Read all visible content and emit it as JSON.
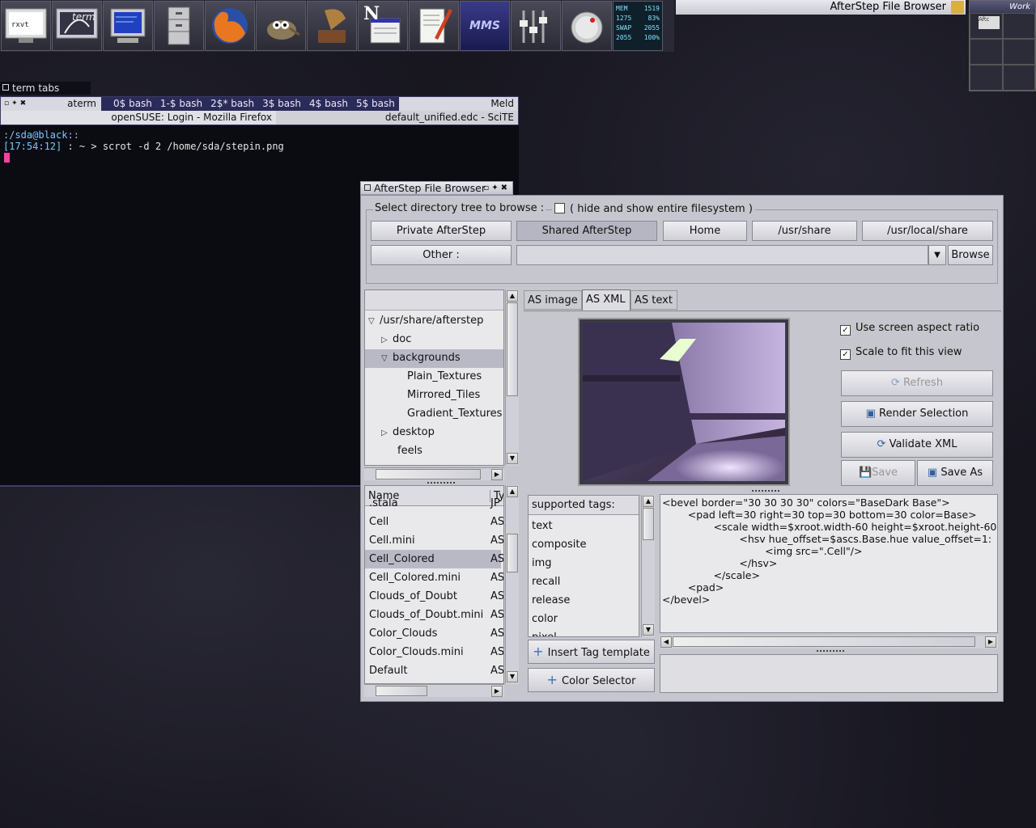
{
  "wharf": {
    "buttons": [
      {
        "name": "rxvt-icon",
        "label": "rxvt"
      },
      {
        "name": "aterm-icon",
        "label": "term"
      },
      {
        "name": "monitor-icon",
        "label": ""
      },
      {
        "name": "file-cabinet-icon",
        "label": ""
      },
      {
        "name": "firefox-icon",
        "label": ""
      },
      {
        "name": "gimp-icon",
        "label": ""
      },
      {
        "name": "gramophone-icon",
        "label": ""
      },
      {
        "name": "netscape-icon",
        "label": "N"
      },
      {
        "name": "notepad-icon",
        "label": ""
      },
      {
        "name": "mms-icon",
        "label": "MMS"
      },
      {
        "name": "mixer-icon",
        "label": ""
      },
      {
        "name": "volume-knob-icon",
        "label": ""
      }
    ],
    "sysmon": [
      [
        "MEM",
        "1519"
      ],
      [
        "1275",
        "83%"
      ],
      [
        "SWAP",
        "2055"
      ],
      [
        "2055",
        "100%"
      ]
    ]
  },
  "top_title": "AfterStep File Browser",
  "pager": {
    "label": "Work",
    "mini_label": "Aftc"
  },
  "term": {
    "tabs_title": "term tabs",
    "row1": [
      "aterm",
      "0$ bash",
      "1-$ bash",
      "2$* bash",
      "3$ bash",
      "4$ bash",
      "5$ bash",
      "Meld"
    ],
    "row2": [
      "openSUSE: Login - Mozilla Firefox",
      "default_unified.edc - SciTE"
    ],
    "prompt_line": ":/sda@black::",
    "time": "[17:54:12]",
    "command": " :  ~  > scrot -d 2 /home/sda/stepin.png"
  },
  "fb": {
    "title": "AfterStep File Browser",
    "select_label": "Select directory tree to browse :",
    "hide_label": "( hide and show entire filesystem )",
    "dir_buttons": [
      "Private AfterStep",
      "Shared AfterStep",
      "Home",
      "/usr/share",
      "/usr/local/share"
    ],
    "other_label": "Other :",
    "other_value": "",
    "browse_label": "Browse",
    "tree": {
      "root": "/usr/share/afterstep",
      "items": [
        {
          "label": "doc",
          "level": 1,
          "arrow": "right"
        },
        {
          "label": "backgrounds",
          "level": 1,
          "arrow": "down",
          "selected": true
        },
        {
          "label": "Plain_Textures",
          "level": 2
        },
        {
          "label": "Mirrored_Tiles",
          "level": 2
        },
        {
          "label": "Gradient_Textures",
          "level": 2
        },
        {
          "label": "desktop",
          "level": 1,
          "arrow": "right"
        },
        {
          "label": "feels",
          "level": 1
        }
      ]
    },
    "list": {
      "col_name": "Name",
      "col_type": "Ty",
      "rows": [
        {
          "name": ".stala",
          "type": "JP"
        },
        {
          "name": "Cell",
          "type": "AS"
        },
        {
          "name": "Cell.mini",
          "type": "AS"
        },
        {
          "name": "Cell_Colored",
          "type": "AS",
          "selected": true
        },
        {
          "name": "Cell_Colored.mini",
          "type": "AS"
        },
        {
          "name": "Clouds_of_Doubt",
          "type": "AS"
        },
        {
          "name": "Clouds_of_Doubt.mini",
          "type": "AS"
        },
        {
          "name": "Color_Clouds",
          "type": "AS"
        },
        {
          "name": "Color_Clouds.mini",
          "type": "AS"
        },
        {
          "name": "Default",
          "type": "AS"
        }
      ]
    },
    "tabs": [
      "AS image",
      "AS XML",
      "AS text"
    ],
    "active_tab": "AS XML",
    "opt_aspect": "Use screen aspect ratio",
    "opt_scale": "Scale to fit this view",
    "btn_refresh": "Refresh",
    "btn_render": "Render Selection",
    "btn_validate": "Validate XML",
    "btn_save": "Save",
    "btn_saveas": "Save As",
    "tags_header": "supported tags:",
    "tags": [
      "text",
      "composite",
      "img",
      "recall",
      "release",
      "color",
      "pixel"
    ],
    "btn_insert": "Insert Tag template",
    "btn_color": "Color Selector",
    "xml_lines": [
      "<bevel border=\"30 30 30 30\" colors=\"BaseDark Base\">",
      "        <pad left=30 right=30 top=30 bottom=30 color=Base>",
      "                <scale width=$xroot.width-60 height=$xroot.height-60",
      "                        <hsv hue_offset=$ascs.Base.hue value_offset=1:",
      "                                <img src=\".Cell\"/>",
      "                        </hsv>",
      "                </scale>",
      "        <pad>",
      "</bevel>"
    ],
    "colors": {
      "accent": "#b9b9c6",
      "window": "#c6c6ce",
      "title_gradient_top": "#e9e9ef"
    }
  }
}
